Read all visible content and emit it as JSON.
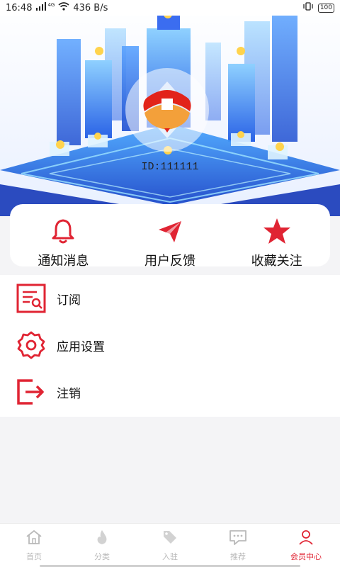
{
  "status_bar": {
    "time": "16:48",
    "network": "4G",
    "speed": "436 B/s",
    "battery": "100"
  },
  "profile": {
    "user_id": "ID:111111"
  },
  "colors": {
    "accent": "#e02433",
    "inactive": "#b9b9b9"
  },
  "quick_actions": [
    {
      "label": "通知消息",
      "icon": "bell-icon"
    },
    {
      "label": "用户反馈",
      "icon": "paper-plane-icon"
    },
    {
      "label": "收藏关注",
      "icon": "star-icon"
    }
  ],
  "menu": [
    {
      "label": "订阅",
      "icon": "subscription-icon"
    },
    {
      "label": "应用设置",
      "icon": "settings-gear-icon"
    },
    {
      "label": "注销",
      "icon": "logout-icon"
    }
  ],
  "tabbar": {
    "active_index": 4,
    "tabs": [
      {
        "label": "首页",
        "icon": "home-icon"
      },
      {
        "label": "分类",
        "icon": "flame-icon"
      },
      {
        "label": "入驻",
        "icon": "tag-icon"
      },
      {
        "label": "推荐",
        "icon": "chat-bubble-icon"
      },
      {
        "label": "会员中心",
        "icon": "user-icon"
      }
    ]
  }
}
